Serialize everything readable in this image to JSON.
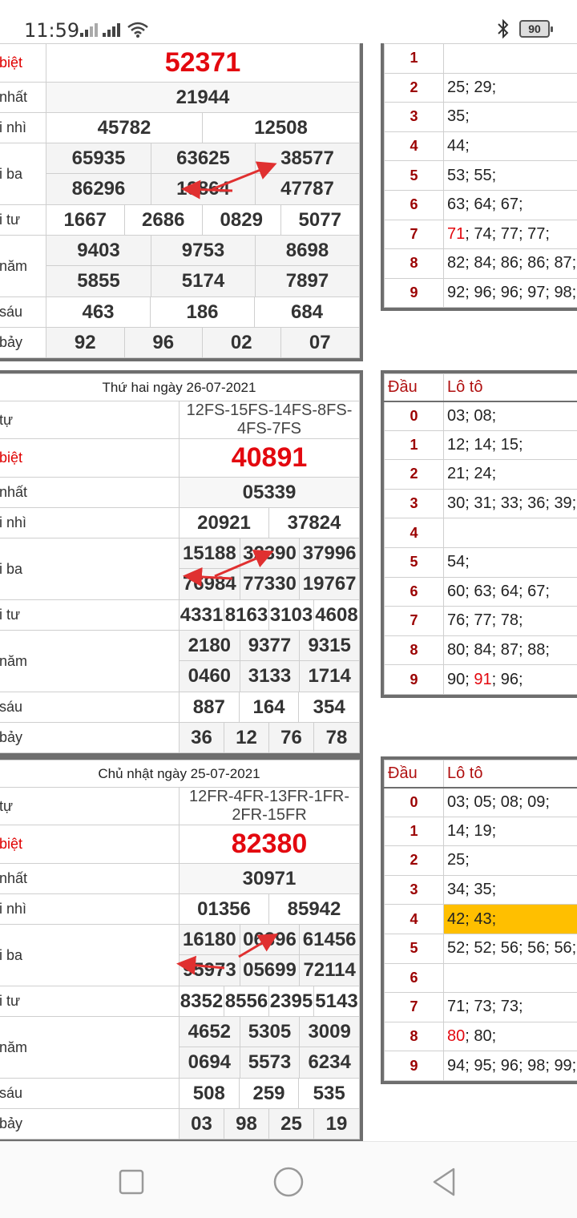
{
  "status_bar": {
    "time": "11:59",
    "battery": "90"
  },
  "results": [
    {
      "date": "",
      "ky": "",
      "rows": [
        {
          "label": "biệt",
          "values": [
            "52371"
          ]
        },
        {
          "label": "nhất",
          "values": [
            "21944"
          ]
        },
        {
          "label": "i nhì",
          "values": [
            "45782",
            "12508"
          ]
        },
        {
          "label": "i ba",
          "values": [
            "65935",
            "63625",
            "38577",
            "86296",
            "19864",
            "47787"
          ]
        },
        {
          "label": "i tư",
          "values": [
            "1667",
            "2686",
            "0829",
            "5077"
          ]
        },
        {
          "label": "năm",
          "values": [
            "9403",
            "9753",
            "8698",
            "5855",
            "5174",
            "7897"
          ]
        },
        {
          "label": "sáu",
          "values": [
            "463",
            "186",
            "684"
          ]
        },
        {
          "label": "bảy",
          "values": [
            "92",
            "96",
            "02",
            "07"
          ]
        }
      ]
    },
    {
      "date": "Thứ hai ngày 26-07-2021",
      "ky_label": "tự",
      "ky": "12FS-15FS-14FS-8FS-4FS-7FS",
      "rows": [
        {
          "label": "biệt",
          "values": [
            "40891"
          ]
        },
        {
          "label": "nhất",
          "values": [
            "05339"
          ]
        },
        {
          "label": "i nhì",
          "values": [
            "20921",
            "37824"
          ]
        },
        {
          "label": "i ba",
          "values": [
            "15188",
            "32390",
            "37996",
            "76984",
            "77330",
            "19767"
          ]
        },
        {
          "label": "i tư",
          "values": [
            "4331",
            "8163",
            "3103",
            "4608"
          ]
        },
        {
          "label": "năm",
          "values": [
            "2180",
            "9377",
            "9315",
            "0460",
            "3133",
            "1714"
          ]
        },
        {
          "label": "sáu",
          "values": [
            "887",
            "164",
            "354"
          ]
        },
        {
          "label": "bảy",
          "values": [
            "36",
            "12",
            "76",
            "78"
          ]
        }
      ]
    },
    {
      "date": "Chủ nhật ngày 25-07-2021",
      "ky_label": "tự",
      "ky": "12FR-4FR-13FR-1FR-2FR-15FR",
      "rows": [
        {
          "label": "biệt",
          "values": [
            "82380"
          ]
        },
        {
          "label": "nhất",
          "values": [
            "30971"
          ]
        },
        {
          "label": "i nhì",
          "values": [
            "01356",
            "85942"
          ]
        },
        {
          "label": "i ba",
          "values": [
            "16180",
            "06396",
            "61456",
            "95973",
            "05699",
            "72114"
          ]
        },
        {
          "label": "i tư",
          "values": [
            "8352",
            "8556",
            "2395",
            "5143"
          ]
        },
        {
          "label": "năm",
          "values": [
            "4652",
            "5305",
            "3009",
            "0694",
            "5573",
            "6234"
          ]
        },
        {
          "label": "sáu",
          "values": [
            "508",
            "259",
            "535"
          ]
        },
        {
          "label": "bảy",
          "values": [
            "03",
            "98",
            "25",
            "19"
          ]
        }
      ]
    }
  ],
  "loto": [
    {
      "header": null,
      "rows": [
        {
          "dau": "1",
          "pre": "",
          "red": "",
          "post": ""
        },
        {
          "dau": "2",
          "pre": "25; 29;",
          "red": "",
          "post": ""
        },
        {
          "dau": "3",
          "pre": "35;",
          "red": "",
          "post": ""
        },
        {
          "dau": "4",
          "pre": "44;",
          "red": "",
          "post": ""
        },
        {
          "dau": "5",
          "pre": "53; 55;",
          "red": "",
          "post": ""
        },
        {
          "dau": "6",
          "pre": "63; 64; 67;",
          "red": "",
          "post": ""
        },
        {
          "dau": "7",
          "pre": "",
          "red": "71",
          "post": "; 74; 77; 77;"
        },
        {
          "dau": "8",
          "pre": "82; 84; 86; 86; 87;",
          "red": "",
          "post": ""
        },
        {
          "dau": "9",
          "pre": "92; 96; 96; 97; 98;",
          "red": "",
          "post": ""
        }
      ]
    },
    {
      "header": {
        "dau": "Đầu",
        "loto": "Lô tô"
      },
      "rows": [
        {
          "dau": "0",
          "pre": "03; 08;",
          "red": "",
          "post": ""
        },
        {
          "dau": "1",
          "pre": "12; 14; 15;",
          "red": "",
          "post": ""
        },
        {
          "dau": "2",
          "pre": "21; 24;",
          "red": "",
          "post": ""
        },
        {
          "dau": "3",
          "pre": "30; 31; 33; 36; 39;",
          "red": "",
          "post": ""
        },
        {
          "dau": "4",
          "pre": "",
          "red": "",
          "post": ""
        },
        {
          "dau": "5",
          "pre": "54;",
          "red": "",
          "post": ""
        },
        {
          "dau": "6",
          "pre": "60; 63; 64; 67;",
          "red": "",
          "post": ""
        },
        {
          "dau": "7",
          "pre": "76; 77; 78;",
          "red": "",
          "post": ""
        },
        {
          "dau": "8",
          "pre": "80; 84; 87; 88;",
          "red": "",
          "post": ""
        },
        {
          "dau": "9",
          "pre": "90; ",
          "red": "91",
          "post": "; 96;"
        }
      ]
    },
    {
      "header": {
        "dau": "Đầu",
        "loto": "Lô tô"
      },
      "rows": [
        {
          "dau": "0",
          "pre": "03; 05; 08; 09;",
          "red": "",
          "post": ""
        },
        {
          "dau": "1",
          "pre": "14; 19;",
          "red": "",
          "post": ""
        },
        {
          "dau": "2",
          "pre": "25;",
          "red": "",
          "post": ""
        },
        {
          "dau": "3",
          "pre": "34; 35;",
          "red": "",
          "post": ""
        },
        {
          "dau": "4",
          "pre": "42; 43;",
          "red": "",
          "post": "",
          "highlight": true
        },
        {
          "dau": "5",
          "pre": "52; 52; 56; 56; 56;",
          "red": "",
          "post": ""
        },
        {
          "dau": "6",
          "pre": "",
          "red": "",
          "post": ""
        },
        {
          "dau": "7",
          "pre": "71; 73; 73;",
          "red": "",
          "post": ""
        },
        {
          "dau": "8",
          "pre": "",
          "red": "80",
          "post": "; 80;"
        },
        {
          "dau": "9",
          "pre": "94; 95; 96; 98; 99;",
          "red": "",
          "post": ""
        }
      ]
    }
  ],
  "colors": {
    "special_prize": "#e3080f",
    "highlight": "#ffbf00",
    "dau": "#9b0000",
    "arrow": "#e03030"
  },
  "icons": [
    "signal-icon",
    "wifi-icon",
    "bluetooth-icon",
    "battery-icon",
    "nav-recents-icon",
    "nav-home-icon",
    "nav-back-icon"
  ]
}
